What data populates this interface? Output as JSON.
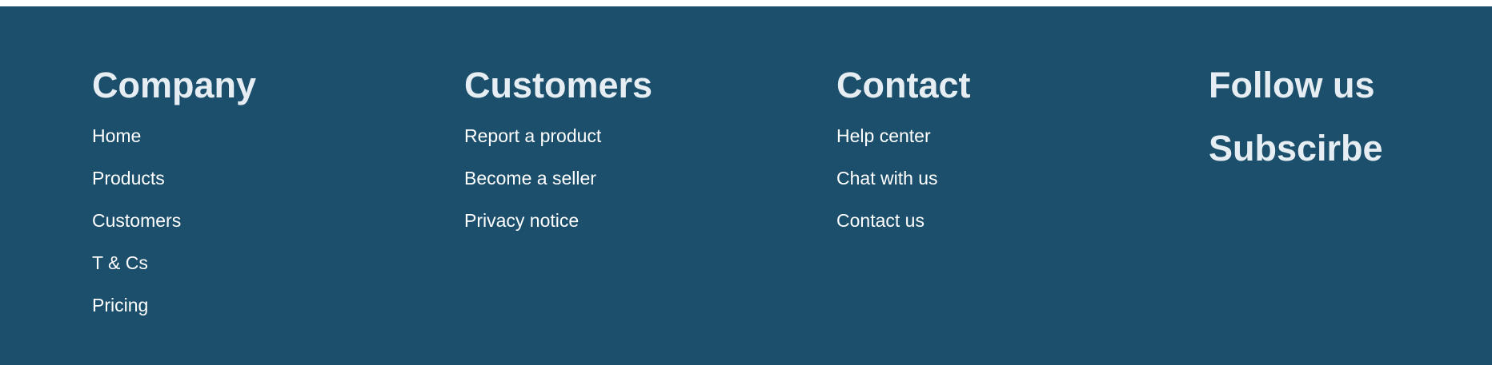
{
  "footer": {
    "columns": [
      {
        "heading": "Company",
        "links": [
          "Home",
          "Products",
          "Customers",
          "T & Cs",
          "Pricing"
        ]
      },
      {
        "heading": "Customers",
        "links": [
          "Report a product",
          "Become a seller",
          "Privacy notice"
        ]
      },
      {
        "heading": "Contact",
        "links": [
          "Help center",
          "Chat with us",
          "Contact us"
        ]
      },
      {
        "heading": "Follow us",
        "subheading": "Subscirbe"
      }
    ]
  },
  "colors": {
    "footer_background": "#1b4f6c",
    "heading_text": "#e6eef3",
    "link_text": "#ffffff",
    "page_background": "#ffffff"
  }
}
